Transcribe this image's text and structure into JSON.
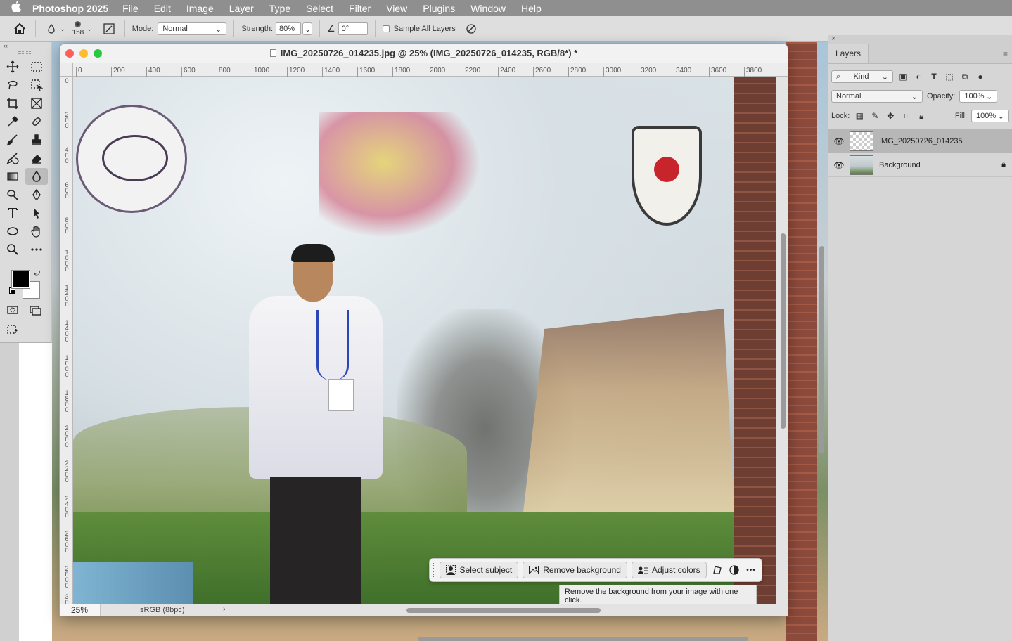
{
  "menubar": {
    "apple": "",
    "app_name": "Photoshop 2025",
    "items": [
      "File",
      "Edit",
      "Image",
      "Layer",
      "Type",
      "Select",
      "Filter",
      "View",
      "Plugins",
      "Window",
      "Help"
    ]
  },
  "options": {
    "brush_size": "158",
    "mode_label": "Mode:",
    "mode_value": "Normal",
    "strength_label": "Strength:",
    "strength_value": "80%",
    "angle_value": "0°",
    "sample_all_label": "Sample All Layers"
  },
  "toolbar": {
    "collapse": "‹‹",
    "active_tool": "blur-tool",
    "foreground_color": "#000000",
    "background_color": "#ffffff"
  },
  "document": {
    "title": "IMG_20250726_014235.jpg @ 25% (IMG_20250726_014235, RGB/8*) *",
    "ruler_x": [
      "0",
      "200",
      "400",
      "600",
      "800",
      "1000",
      "1200",
      "1400",
      "1600",
      "1800",
      "2000",
      "2200",
      "2400",
      "2600",
      "2800",
      "3000",
      "3200",
      "3400",
      "3600",
      "3800"
    ],
    "ruler_y": [
      "0",
      "200",
      "400",
      "600",
      "800",
      "1000",
      "1200",
      "1400",
      "1600",
      "1800",
      "2000",
      "2200",
      "2400",
      "2600",
      "2800",
      "3000"
    ],
    "zoom": "25%",
    "color_profile": "sRGB (8bpc)",
    "status_arrow": "›"
  },
  "taskbar": {
    "select_subject": "Select subject",
    "remove_background": "Remove background",
    "adjust_colors": "Adjust colors",
    "more": "•••",
    "tooltip": "Remove the background from your image with one click."
  },
  "layers_panel": {
    "tab": "Layers",
    "menu": "≡",
    "kind_label": "Kind",
    "blend_mode": "Normal",
    "opacity_label": "Opacity:",
    "opacity_value": "100%",
    "lock_label": "Lock:",
    "fill_label": "Fill:",
    "fill_value": "100%",
    "layers": [
      {
        "name": "IMG_20250726_014235",
        "selected": true,
        "locked": false
      },
      {
        "name": "Background",
        "selected": false,
        "locked": true
      }
    ]
  },
  "colors": {
    "close": "#ff5f57",
    "minimize": "#febc2e",
    "maximize": "#28c840"
  }
}
